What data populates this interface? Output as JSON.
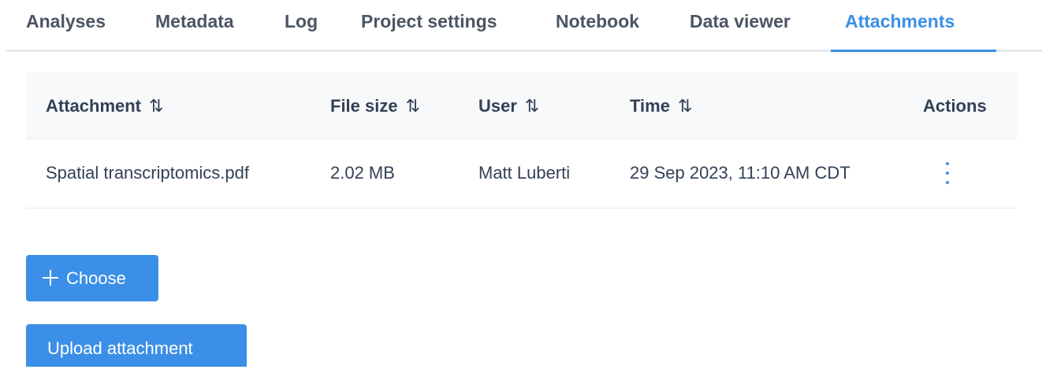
{
  "tabs": [
    {
      "label": "Analyses"
    },
    {
      "label": "Metadata"
    },
    {
      "label": "Log"
    },
    {
      "label": "Project settings"
    },
    {
      "label": "Notebook"
    },
    {
      "label": "Data viewer"
    },
    {
      "label": "Attachments",
      "active": true
    }
  ],
  "table": {
    "columns": [
      "Attachment",
      "File size",
      "User",
      "Time",
      "Actions"
    ],
    "rows": [
      {
        "attachment": "Spatial transcriptomics.pdf",
        "file_size": "2.02 MB",
        "user": "Matt Luberti",
        "time": "29 Sep 2023, 11:10 AM CDT",
        "actions_icon": "kebab-menu-icon"
      }
    ],
    "sort_icon": "⇅"
  },
  "buttons": {
    "choose_label": "Choose",
    "upload_label": "Upload attachment"
  },
  "colors": {
    "accent": "#3b8fe6",
    "header_bg": "#f8f9fb",
    "border": "#e5e7eb",
    "text": "#334155"
  }
}
